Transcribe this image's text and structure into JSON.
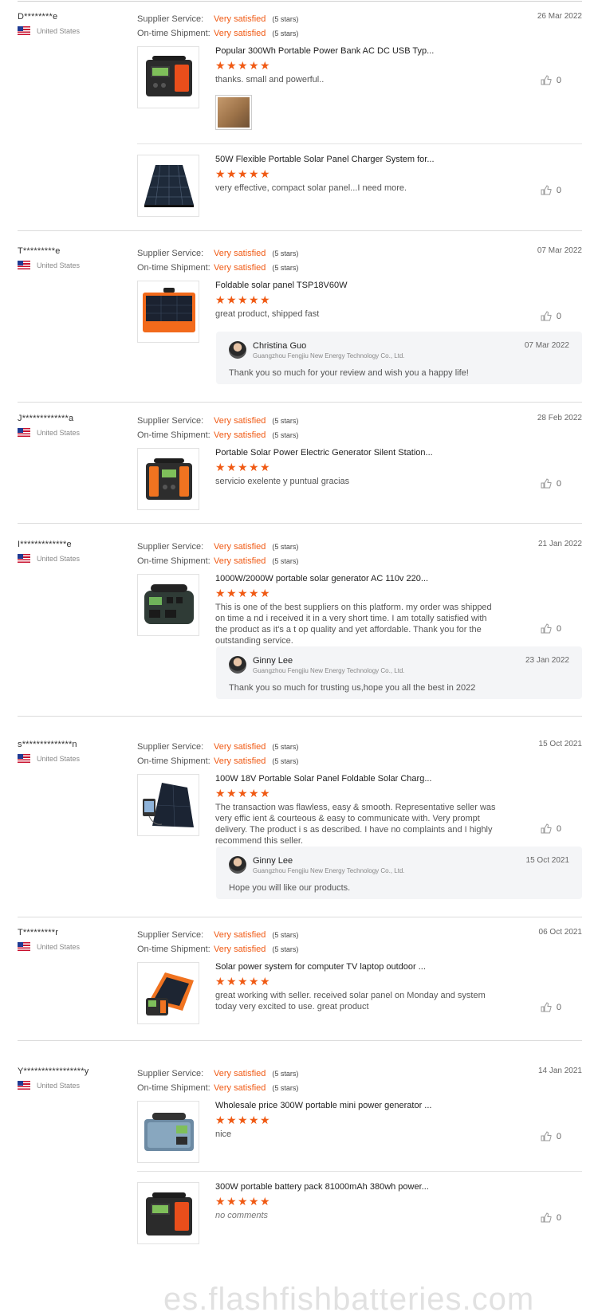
{
  "labels": {
    "supplier_service": "Supplier Service:",
    "ontime_shipment": "On-time Shipment:",
    "rating_value": "Very satisfied",
    "rating_stars": "(5 stars)"
  },
  "reviews": [
    {
      "user": "D********e",
      "country": "United States",
      "date": "26 Mar 2022",
      "products": [
        {
          "title": "Popular 300Wh Portable Power Bank AC DC USB Typ...",
          "comment": "thanks. small and powerful..",
          "likes": "0",
          "has_photo": true
        },
        {
          "title": "50W Flexible Portable Solar Panel Charger System for...",
          "comment": "very effective, compact solar panel...I need more.",
          "likes": "0"
        }
      ]
    },
    {
      "user": "T*********e",
      "country": "United States",
      "date": "07 Mar 2022",
      "products": [
        {
          "title": "Foldable solar panel TSP18V60W",
          "comment": "great product, shipped fast",
          "likes": "0"
        }
      ],
      "reply": {
        "name": "Christina Guo",
        "company": "Guangzhou Fengjiu New Energy Technology Co., Ltd.",
        "date": "07 Mar 2022",
        "text": "Thank you so much for your review and wish you a happy life!"
      }
    },
    {
      "user": "J*************a",
      "country": "United States",
      "date": "28 Feb 2022",
      "products": [
        {
          "title": "Portable Solar Power Electric Generator Silent Station...",
          "comment": "servicio exelente y puntual gracias",
          "likes": "0"
        }
      ]
    },
    {
      "user": "I*************e",
      "country": "United States",
      "date": "21 Jan 2022",
      "products": [
        {
          "title": "1000W/2000W portable solar generator AC 110v 220...",
          "comment": "This is one of the best suppliers on this platform. my order was shipped on time a nd i received it in a very short time. I am totally satisfied with the product as it's a t op quality and yet affordable. Thank you for the outstanding service.",
          "likes": "0"
        }
      ],
      "reply": {
        "name": "Ginny Lee",
        "company": "Guangzhou Fengjiu New Energy Technology Co., Ltd.",
        "date": "23 Jan 2022",
        "text": "Thank you so much for trusting us,hope you all the best in 2022"
      }
    },
    {
      "user": "s**************n",
      "country": "United States",
      "date": "15 Oct 2021",
      "products": [
        {
          "title": "100W 18V Portable Solar Panel Foldable Solar Charg...",
          "comment": "The transaction was flawless, easy & smooth. Representative seller was very effic ient & courteous & easy to communicate with. Very prompt delivery. The product i s as described. I have no complaints and I highly recommend this seller.",
          "likes": "0"
        }
      ],
      "reply": {
        "name": "Ginny Lee",
        "company": "Guangzhou Fengjiu New Energy Technology Co., Ltd.",
        "date": "15 Oct 2021",
        "text": "Hope you will like our products."
      }
    },
    {
      "user": "T*********r",
      "country": "United States",
      "date": "06 Oct 2021",
      "products": [
        {
          "title": "Solar power system for computer TV laptop outdoor ...",
          "comment": "great working with seller. received solar panel on Monday and system today very excited to use. great product",
          "likes": "0"
        }
      ]
    },
    {
      "user": "Y*****************y",
      "country": "United States",
      "date": "14 Jan 2021",
      "products": [
        {
          "title": "Wholesale price 300W portable mini power generator ...",
          "comment": "nice",
          "likes": "0"
        },
        {
          "title": "300W portable battery pack 81000mAh 380wh power...",
          "comment": "no comments",
          "likes": "0"
        }
      ]
    }
  ],
  "watermark": "es.flashfishbatteries.com"
}
